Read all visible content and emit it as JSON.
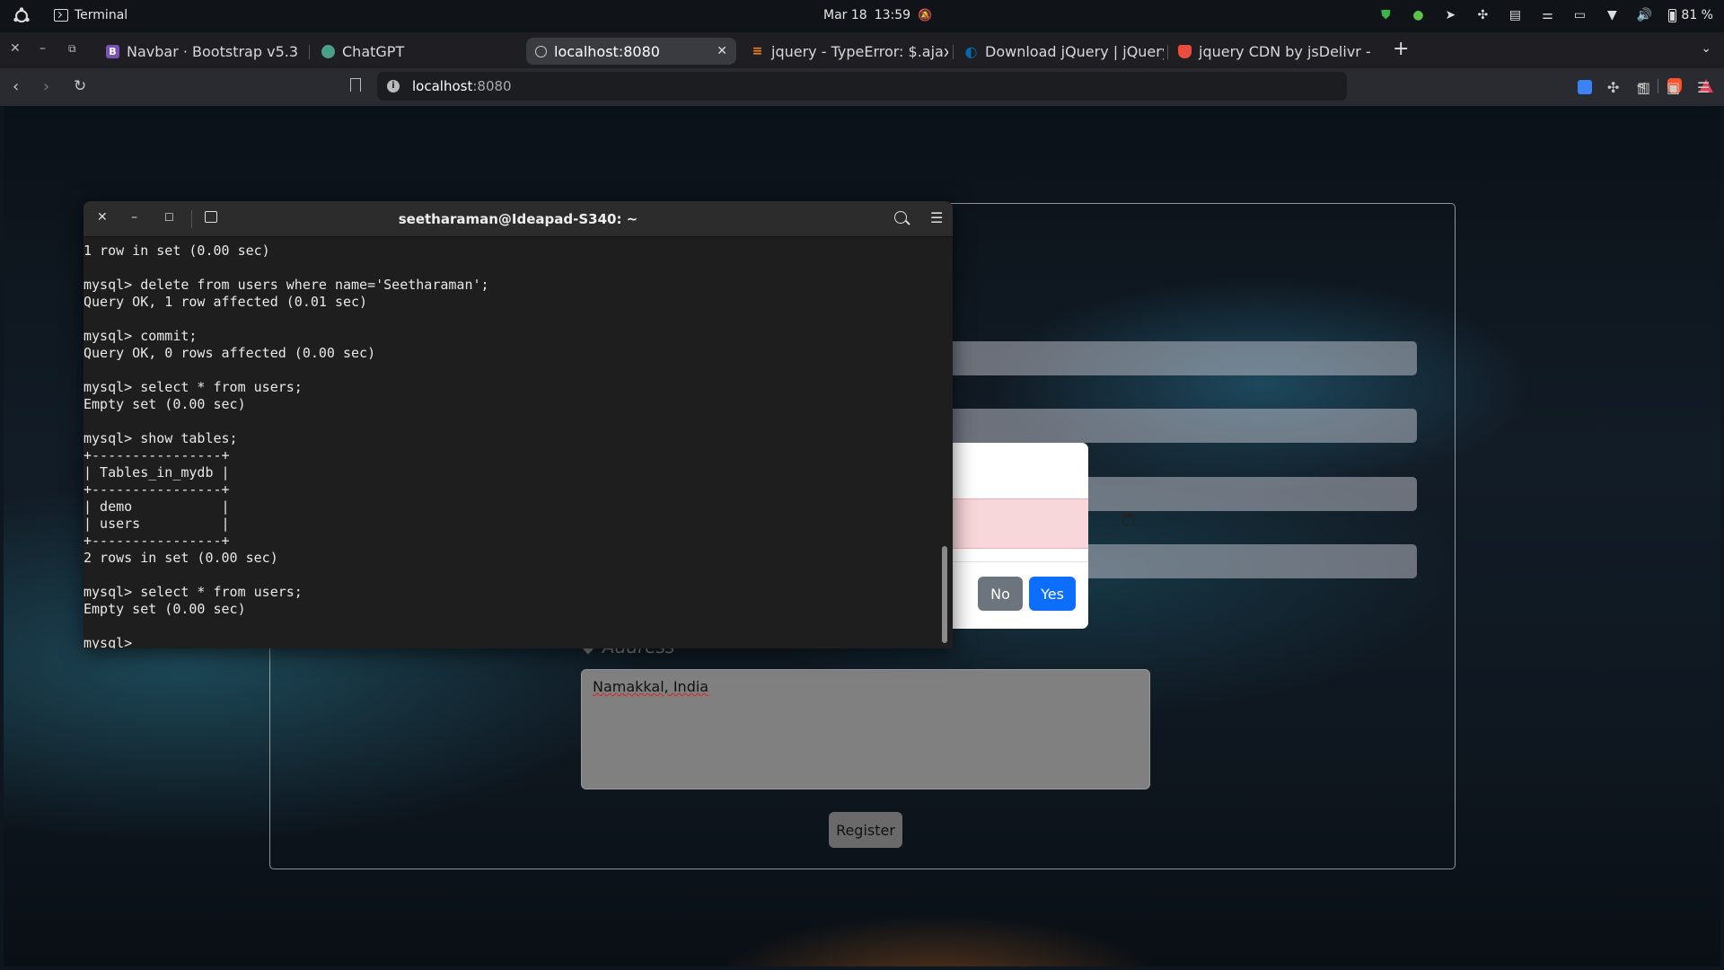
{
  "topbar": {
    "app_name": "Terminal",
    "date": "Mar 18",
    "time": "13:59",
    "battery": "81 %"
  },
  "tabs": [
    {
      "label": "Navbar · Bootstrap v5.3",
      "icon": "bootstrap-icon",
      "fav_color": "#7952b3",
      "fav_text": "B"
    },
    {
      "label": "ChatGPT",
      "icon": "chatgpt-icon",
      "fav_color": "#4aa08a",
      "fav_text": ""
    },
    {
      "label": "localhost:8080",
      "icon": "globe-icon",
      "fav_color": "#888888",
      "fav_text": "",
      "active": true
    },
    {
      "label": "jquery - TypeError: $.ajax",
      "icon": "stackoverflow-icon",
      "fav_color": "#f48024",
      "fav_text": ""
    },
    {
      "label": "Download jQuery | jQuery",
      "icon": "jquery-icon",
      "fav_color": "#0769ad",
      "fav_text": ""
    },
    {
      "label": "jquery CDN by jsDelivr - A",
      "icon": "jsdelivr-icon",
      "fav_color": "#e84d3d",
      "fav_text": ""
    }
  ],
  "urlbar": {
    "host": "localhost",
    "port": ":8080"
  },
  "page": {
    "address_label": "Address",
    "address_value": "Namakkal, India",
    "register_label": "Register"
  },
  "modal": {
    "no_label": "No",
    "yes_label": "Yes"
  },
  "terminal": {
    "title": "seetharaman@Ideapad-S340: ~",
    "lines": [
      "1 row in set (0.00 sec)",
      "",
      "mysql> delete from users where name='Seetharaman';",
      "Query OK, 1 row affected (0.01 sec)",
      "",
      "mysql> commit;",
      "Query OK, 0 rows affected (0.00 sec)",
      "",
      "mysql> select * from users;",
      "Empty set (0.00 sec)",
      "",
      "mysql> show tables;",
      "+----------------+",
      "| Tables_in_mydb |",
      "+----------------+",
      "| demo           |",
      "| users          |",
      "+----------------+",
      "2 rows in set (0.00 sec)",
      "",
      "mysql> select * from users;",
      "Empty set (0.00 sec)",
      ""
    ],
    "prompt": "mysql> "
  }
}
